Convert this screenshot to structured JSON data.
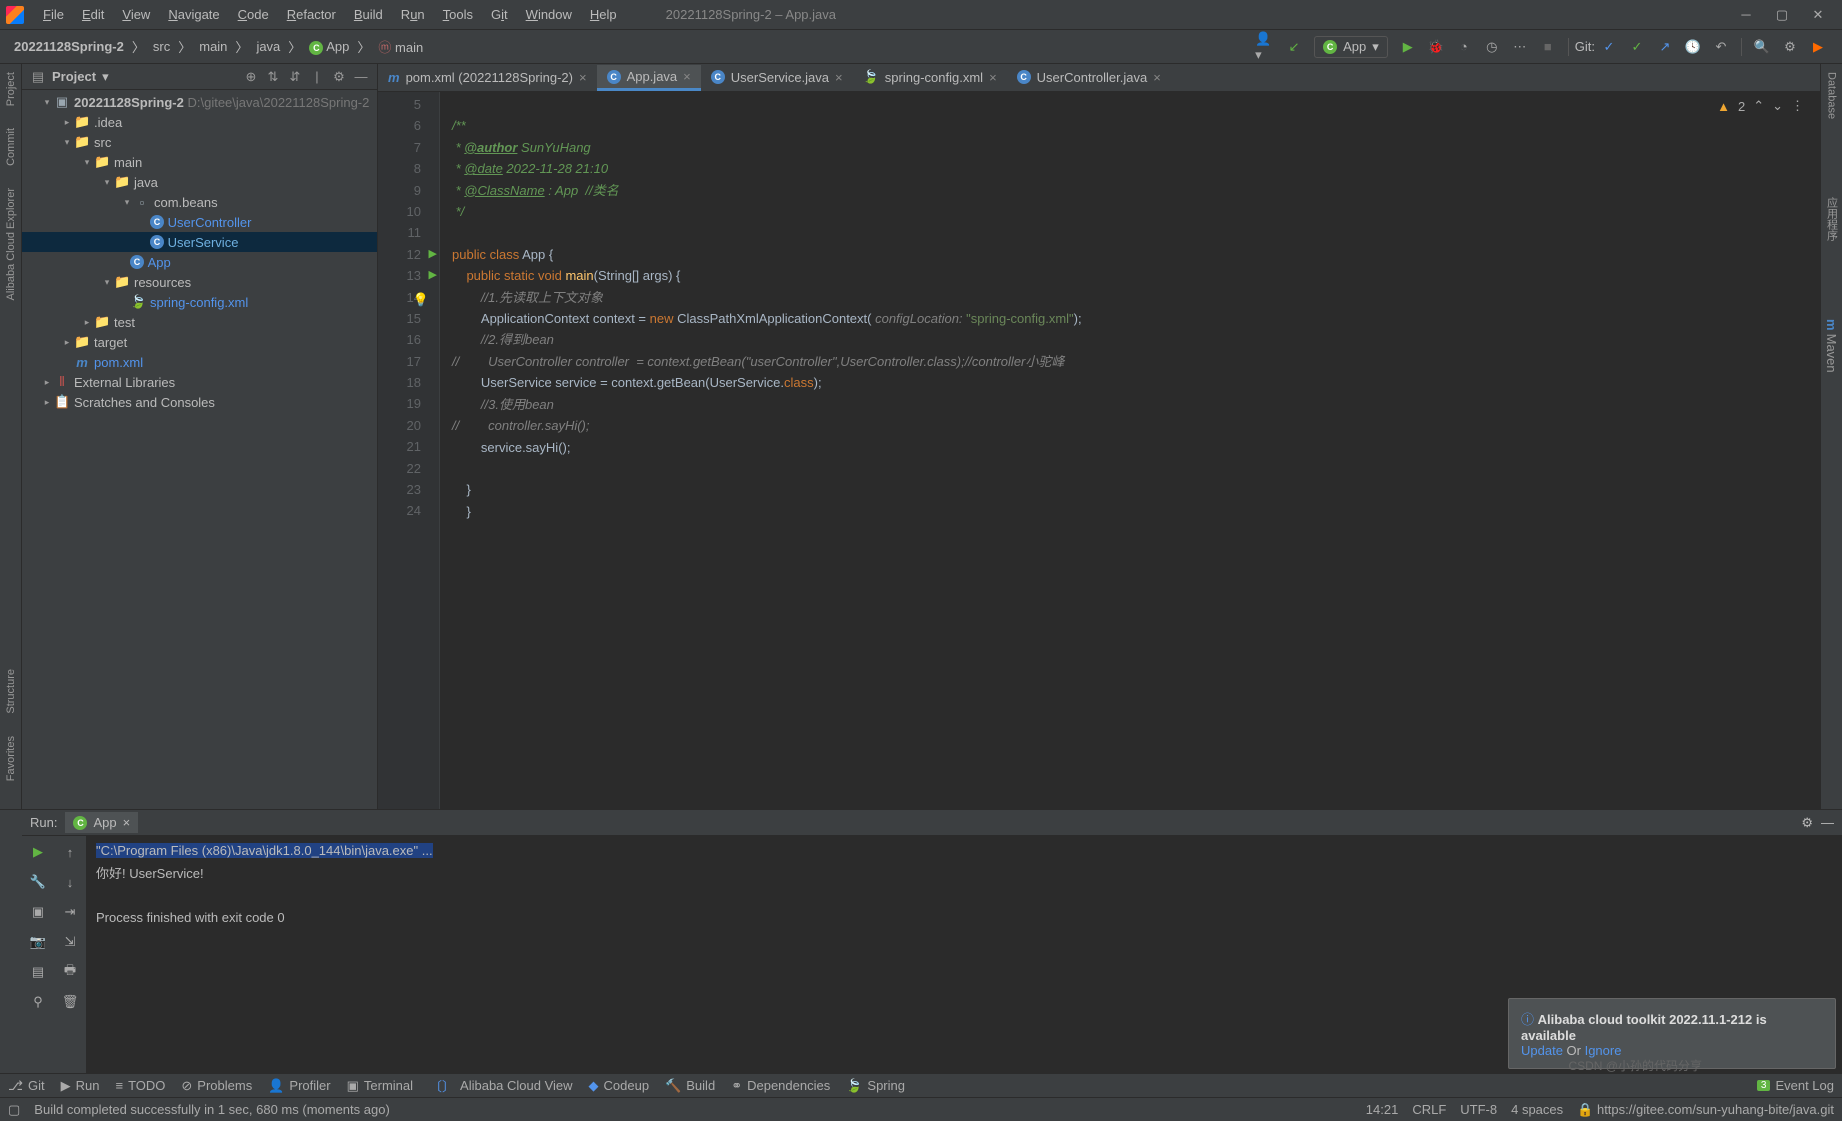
{
  "window_title": "20221128Spring-2 – App.java",
  "menu": [
    "File",
    "Edit",
    "View",
    "Navigate",
    "Code",
    "Refactor",
    "Build",
    "Run",
    "Tools",
    "Git",
    "Window",
    "Help"
  ],
  "breadcrumbs": [
    "20221128Spring-2",
    "src",
    "main",
    "java",
    "App",
    "main"
  ],
  "run_config": "App",
  "git_label": "Git:",
  "project_label": "Project",
  "tree": {
    "root": "20221128Spring-2",
    "root_path": "D:\\gitee\\java\\20221128Spring-2",
    "idea": ".idea",
    "src": "src",
    "main": "main",
    "java": "java",
    "pkg": "com.beans",
    "userController": "UserController",
    "userService": "UserService",
    "app": "App",
    "resources": "resources",
    "springConfig": "spring-config.xml",
    "test": "test",
    "target": "target",
    "pom": "pom.xml",
    "extLib": "External Libraries",
    "scratches": "Scratches and Consoles"
  },
  "tabs": [
    {
      "label": "pom.xml (20221128Spring-2)",
      "type": "m"
    },
    {
      "label": "App.java",
      "type": "c",
      "active": true
    },
    {
      "label": "UserService.java",
      "type": "c"
    },
    {
      "label": "spring-config.xml",
      "type": "x"
    },
    {
      "label": "UserController.java",
      "type": "c"
    }
  ],
  "warnings": "2",
  "code_lines": {
    "5": "",
    "6": "/**",
    "7": " * @author SunYuHang",
    "8": " * @date 2022-11-28 21:10",
    "9": " * @ClassName : App  //类名",
    "10": " */",
    "11": "",
    "12": "public class App {",
    "13": "    public static void main(String[] args) {",
    "14": "        //1.先读取上下文对象",
    "15": "        ApplicationContext context = new ClassPathXmlApplicationContext( configLocation: \"spring-config.xml\");",
    "16": "        //2.得到bean",
    "17": "//        UserController controller  = context.getBean(\"userController\",UserController.class);//controller小驼峰",
    "18": "        UserService service = context.getBean(UserService.class);",
    "19": "        //3.使用bean",
    "20": "//        controller.sayHi();",
    "21": "        service.sayHi();",
    "22": "",
    "23": "    }",
    "24": "    }"
  },
  "run_label": "Run:",
  "run_tab": "App",
  "console": {
    "cmd": "\"C:\\Program Files (x86)\\Java\\jdk1.8.0_144\\bin\\java.exe\" ...",
    "out1": "你好! UserService!",
    "out2": "Process finished with exit code 0"
  },
  "notification": {
    "title": "Alibaba cloud toolkit 2022.11.1-212 is available",
    "update": "Update",
    "or": " Or ",
    "ignore": "Ignore"
  },
  "bottom_tools": [
    "Git",
    "Run",
    "TODO",
    "Problems",
    "Profiler",
    "Terminal",
    "Alibaba Cloud View",
    "Codeup",
    "Build",
    "Dependencies",
    "Spring"
  ],
  "event_log": "Event Log",
  "event_badge": "3",
  "status": {
    "msg": "Build completed successfully in 1 sec, 680 ms (moments ago)",
    "pos": "14:21",
    "crlf": "CRLF",
    "enc": "UTF-8",
    "indent": "4 spaces",
    "git": "https://gitee.com/sun-yuhang-bite/java.git"
  },
  "left_labels": [
    "Project",
    "Commit",
    "Alibaba Cloud Explorer",
    "Structure",
    "Favorites"
  ],
  "right_labels": [
    "Database",
    "应用程序",
    "Maven"
  ],
  "watermark": "CSDN @小孙的代码分享"
}
